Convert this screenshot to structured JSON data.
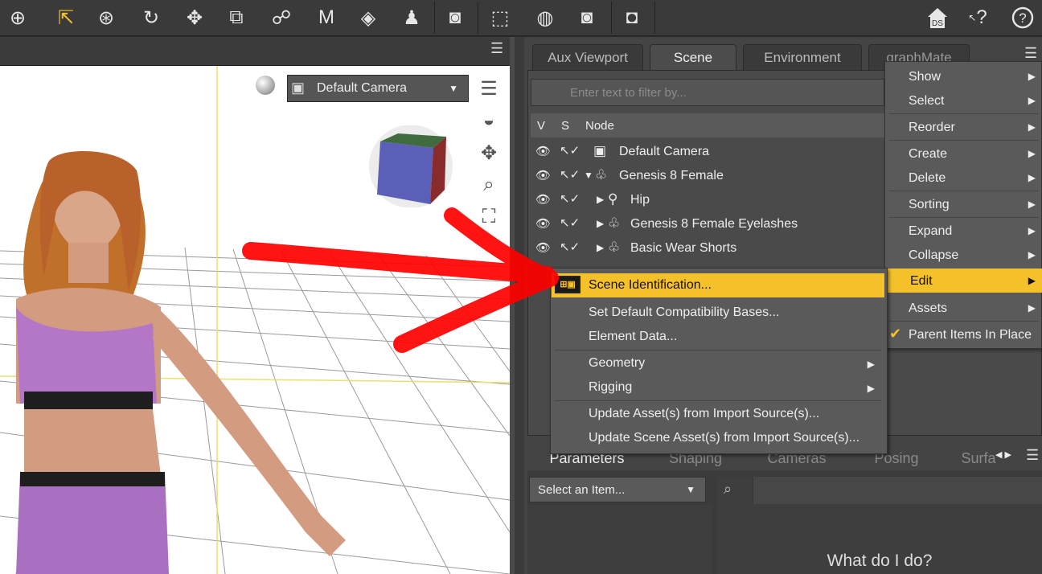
{
  "toolbar": {
    "tools": [
      "universal-tool",
      "node-selection-tool",
      "orbit-tool",
      "rotate-tool",
      "translate-tool",
      "scale-tool",
      "joint-editor-tool",
      "morph-tool",
      "surface-selection-tool",
      "figure-tool",
      "render-tool",
      "region-select-tool",
      "spot-render-tool",
      "render-settings-tool",
      "camera-tool"
    ],
    "right_icons": [
      "ds-home-icon",
      "whats-this-icon",
      "help-icon"
    ],
    "ds_label": "DS",
    "help_q": "?"
  },
  "viewport": {
    "camera": "Default Camera"
  },
  "dock_tabs": [
    {
      "label": "Aux Viewport",
      "selected": false
    },
    {
      "label": "Scene",
      "selected": true
    },
    {
      "label": "Environment",
      "selected": false
    },
    {
      "label": "graphMate",
      "selected": false
    }
  ],
  "scene": {
    "filter_placeholder": "Enter text to filter by...",
    "columns": {
      "v": "V",
      "s": "S",
      "node": "Node"
    },
    "nodes": [
      {
        "label": "Default Camera",
        "indent": 0,
        "expander": ""
      },
      {
        "label": "Genesis 8 Female",
        "indent": 0,
        "expander": "▼"
      },
      {
        "label": "Hip",
        "indent": 1,
        "expander": "▶"
      },
      {
        "label": "Genesis 8 Female Eyelashes",
        "indent": 1,
        "expander": "▶"
      },
      {
        "label": "Basic Wear Shorts",
        "indent": 1,
        "expander": "▶"
      }
    ]
  },
  "context_menu": {
    "items": [
      {
        "label": "Show",
        "submenu": true
      },
      {
        "label": "Select",
        "submenu": true
      },
      {
        "label": "Reorder",
        "submenu": true
      },
      {
        "label": "Create",
        "submenu": true
      },
      {
        "label": "Delete",
        "submenu": true
      },
      {
        "label": "Sorting",
        "submenu": true
      },
      {
        "label": "Expand",
        "submenu": true
      },
      {
        "label": "Collapse",
        "submenu": true
      },
      {
        "label": "Edit",
        "submenu": true,
        "highlighted": true
      },
      {
        "label": "Assets",
        "submenu": true
      },
      {
        "label": "Parent Items In Place",
        "checked": true
      }
    ]
  },
  "edit_submenu": {
    "items": [
      {
        "label": "Scene Identification...",
        "highlighted": true
      },
      {
        "label": "Set Default Compatibility Bases..."
      },
      {
        "label": "Element Data..."
      },
      {
        "label": "Geometry",
        "submenu": true
      },
      {
        "label": "Rigging",
        "submenu": true
      },
      {
        "label": "Update Asset(s) from Import Source(s)..."
      },
      {
        "label": "Update Scene Asset(s) from Import Source(s)..."
      }
    ]
  },
  "param_tabs": [
    {
      "label": "Parameters",
      "selected": true
    },
    {
      "label": "Shaping",
      "selected": false
    },
    {
      "label": "Cameras",
      "selected": false
    },
    {
      "label": "Posing",
      "selected": false
    },
    {
      "label": "Surfa",
      "selected": false
    }
  ],
  "params": {
    "item_select": "Select an Item...",
    "help_text": "What do I do?"
  },
  "colors": {
    "highlight": "#f5c12a",
    "annotation": "#ff0000"
  }
}
